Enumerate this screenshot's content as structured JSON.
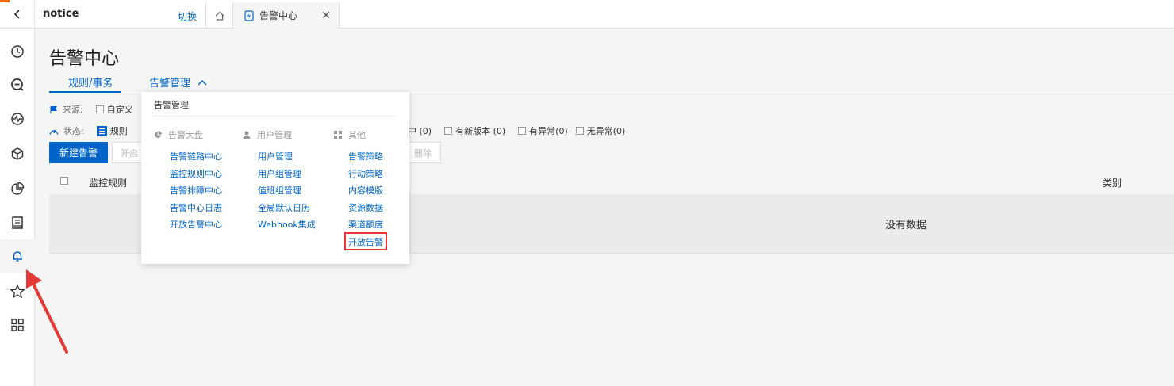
{
  "colors": {
    "accent": "#0064c8",
    "orange": "#ff6a00",
    "highlight": "#e53935"
  },
  "topbar": {
    "app_name": "notice",
    "switch_label": "切换",
    "tab_label": "告警中心",
    "close_glyph": "✕"
  },
  "sidebar": {
    "items": [
      "clock-icon",
      "search-icon",
      "monitor-icon",
      "cube-icon",
      "pie-chart-icon",
      "book-icon",
      "bell-icon",
      "star-icon",
      "grid-icon"
    ],
    "active": "bell-icon"
  },
  "page": {
    "title": "告警中心",
    "tabs": [
      {
        "label": "规则/事务"
      },
      {
        "label": "告警管理"
      }
    ],
    "filters": {
      "source_label": "来源:",
      "source_option": "自定义",
      "status_label": "状态:",
      "status_option": "规则",
      "status_suffix": "中  (0)",
      "opt_new_version": "有新版本  (0)",
      "opt_abnormal": "有异常(0)",
      "opt_normal": "无异常(0)"
    },
    "actions": {
      "create": "新建告警",
      "enable": "开启",
      "delete": "删除"
    },
    "table": {
      "columns": [
        "监控规则",
        "类别"
      ],
      "empty": "没有数据"
    }
  },
  "dropdown": {
    "title": "告警管理",
    "columns": [
      {
        "title": "告警大盘",
        "icon": "pie-chart-icon",
        "items": [
          "告警链路中心",
          "监控规则中心",
          "告警排障中心",
          "告警中心日志",
          "开放告警中心"
        ]
      },
      {
        "title": "用户管理",
        "icon": "user-icon",
        "items": [
          "用户管理",
          "用户组管理",
          "值班组管理",
          "全局默认日历",
          "Webhook集成"
        ]
      },
      {
        "title": "其他",
        "icon": "grid-icon",
        "items": [
          "告警策略",
          "行动策略",
          "内容模版",
          "资源数据",
          "渠道额度",
          "开放告警"
        ]
      }
    ],
    "highlighted": "开放告警"
  },
  "annotation": {
    "arrow": "red-arrow-pointing-to-bell"
  }
}
